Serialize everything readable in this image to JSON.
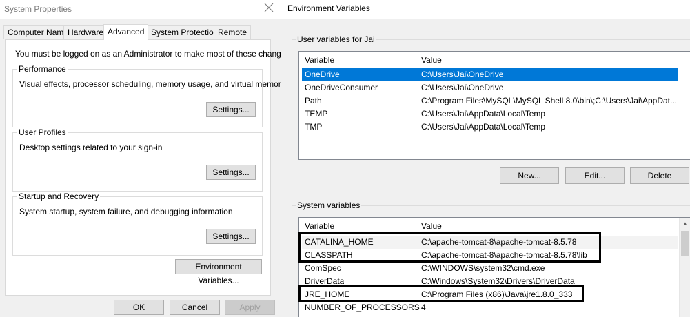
{
  "system_properties": {
    "title": "System Properties",
    "tabs": [
      {
        "label": "Computer Name",
        "active": false
      },
      {
        "label": "Hardware",
        "active": false
      },
      {
        "label": "Advanced",
        "active": true
      },
      {
        "label": "System Protection",
        "active": false
      },
      {
        "label": "Remote",
        "active": false
      }
    ],
    "admin_message": "You must be logged on as an Administrator to make most of these changes.",
    "groups": [
      {
        "title": "Performance",
        "description": "Visual effects, processor scheduling, memory usage, and virtual memory",
        "button": "Settings..."
      },
      {
        "title": "User Profiles",
        "description": "Desktop settings related to your sign-in",
        "button": "Settings..."
      },
      {
        "title": "Startup and Recovery",
        "description": "System startup, system failure, and debugging information",
        "button": "Settings..."
      }
    ],
    "env_vars_button": "Environment Variables...",
    "ok_button": "OK",
    "cancel_button": "Cancel",
    "apply_button": "Apply",
    "close_icon": "close-icon"
  },
  "environment_variables": {
    "title": "Environment Variables",
    "user_section": {
      "title": "User variables for Jai",
      "columns": [
        "Variable",
        "Value"
      ],
      "rows": [
        {
          "variable": "OneDrive",
          "value": "C:\\Users\\Jai\\OneDrive",
          "selected": true
        },
        {
          "variable": "OneDriveConsumer",
          "value": "C:\\Users\\Jai\\OneDrive",
          "selected": false
        },
        {
          "variable": "Path",
          "value": "C:\\Program Files\\MySQL\\MySQL Shell 8.0\\bin\\;C:\\Users\\Jai\\AppDat...",
          "selected": false
        },
        {
          "variable": "TEMP",
          "value": "C:\\Users\\Jai\\AppData\\Local\\Temp",
          "selected": false
        },
        {
          "variable": "TMP",
          "value": "C:\\Users\\Jai\\AppData\\Local\\Temp",
          "selected": false
        }
      ],
      "buttons": {
        "new": "New...",
        "edit": "Edit...",
        "delete": "Delete"
      }
    },
    "system_section": {
      "title": "System variables",
      "columns": [
        "Variable",
        "Value"
      ],
      "rows": [
        {
          "variable": "CATALINA_HOME",
          "value": "C:\\apache-tomcat-8\\apache-tomcat-8.5.78",
          "highlighted": true
        },
        {
          "variable": "CLASSPATH",
          "value": "C:\\apache-tomcat-8\\apache-tomcat-8.5.78\\lib",
          "highlighted": true
        },
        {
          "variable": "ComSpec",
          "value": "C:\\WINDOWS\\system32\\cmd.exe",
          "highlighted": false
        },
        {
          "variable": "DriverData",
          "value": "C:\\Windows\\System32\\Drivers\\DriverData",
          "highlighted": false
        },
        {
          "variable": "JRE_HOME",
          "value": "C:\\Program Files (x86)\\Java\\jre1.8.0_333",
          "highlighted": true
        },
        {
          "variable": "NUMBER_OF_PROCESSORS",
          "value": "4",
          "highlighted": false
        }
      ]
    }
  }
}
